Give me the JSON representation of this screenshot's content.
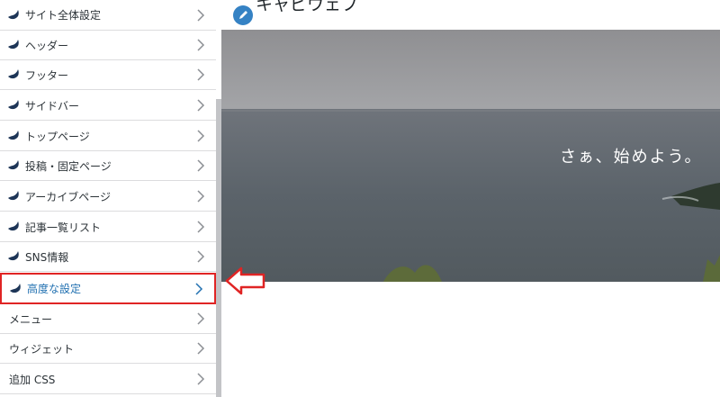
{
  "sidebar": {
    "items": [
      {
        "label": "サイト全体設定",
        "icon": "bird-icon"
      },
      {
        "label": "ヘッダー",
        "icon": "bird-icon"
      },
      {
        "label": "フッター",
        "icon": "bird-icon"
      },
      {
        "label": "サイドバー",
        "icon": "bird-icon"
      },
      {
        "label": "トップページ",
        "icon": "bird-icon"
      },
      {
        "label": "投稿・固定ページ",
        "icon": "bird-icon"
      },
      {
        "label": "アーカイブページ",
        "icon": "bird-icon"
      },
      {
        "label": "記事一覧リスト",
        "icon": "bird-icon"
      },
      {
        "label": "SNS情報",
        "icon": "bird-icon"
      },
      {
        "label": "高度な設定",
        "icon": "bird-icon",
        "active": true
      },
      {
        "label": "メニュー"
      },
      {
        "label": "ウィジェット"
      },
      {
        "label": "追加 CSS"
      }
    ]
  },
  "preview": {
    "site_title": "キャビウェブ",
    "hero_text": "さぁ、始めよう。"
  },
  "colors": {
    "accent": "#2271b1",
    "highlight_border": "#e02424",
    "edit_badge": "#3582c4"
  }
}
